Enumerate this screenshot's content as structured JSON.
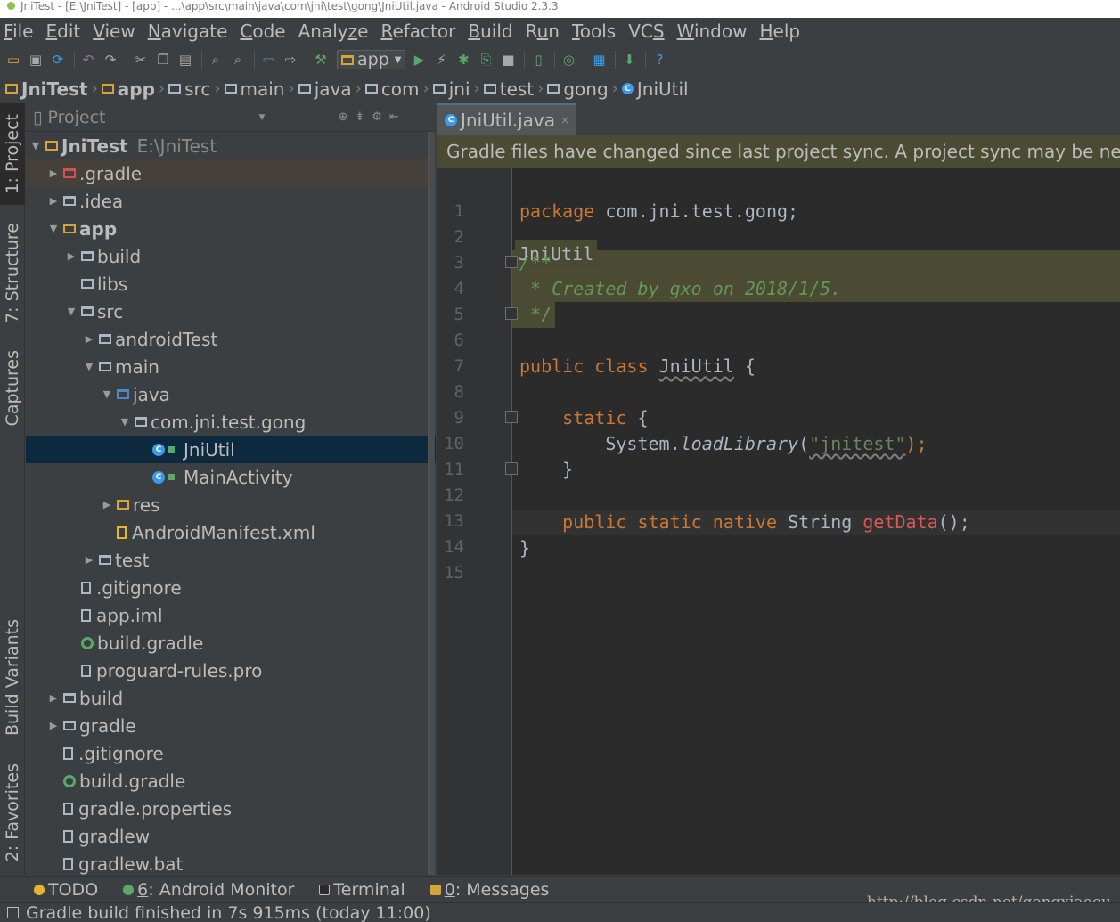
{
  "window": {
    "title": "JniTest - [E:\\JniTest] - [app] - ...\\app\\src\\main\\java\\com\\jni\\test\\gong\\JniUtil.java - Android Studio 2.3.3"
  },
  "menu": [
    {
      "mnemonic": "F",
      "rest": "ile"
    },
    {
      "mnemonic": "E",
      "rest": "dit"
    },
    {
      "mnemonic": "V",
      "rest": "iew"
    },
    {
      "mnemonic": "N",
      "rest": "avigate"
    },
    {
      "mnemonic": "C",
      "rest": "ode"
    },
    {
      "pre": "Analy",
      "mnemonic": "z",
      "rest": "e"
    },
    {
      "mnemonic": "R",
      "rest": "efactor"
    },
    {
      "mnemonic": "B",
      "rest": "uild"
    },
    {
      "pre": "R",
      "mnemonic": "u",
      "rest": "n"
    },
    {
      "mnemonic": "T",
      "rest": "ools"
    },
    {
      "pre": "VC",
      "mnemonic": "S",
      "rest": ""
    },
    {
      "mnemonic": "W",
      "rest": "indow"
    },
    {
      "mnemonic": "H",
      "rest": "elp"
    }
  ],
  "toolbar": {
    "run_config": "app"
  },
  "breadcrumbs": [
    "JniTest",
    "app",
    "src",
    "main",
    "java",
    "com",
    "jni",
    "test",
    "gong",
    "JniUtil"
  ],
  "project_panel": {
    "title": "Project",
    "root_name": "JniTest",
    "root_path": "E:\\JniTest",
    "items": [
      ".gradle",
      ".idea",
      "app",
      "build",
      "libs",
      "src",
      "androidTest",
      "main",
      "java",
      "com.jni.test.gong",
      "JniUtil",
      "MainActivity",
      "res",
      "AndroidManifest.xml",
      "test",
      ".gitignore",
      "app.iml",
      "build.gradle",
      "proguard-rules.pro",
      "build",
      "gradle",
      ".gitignore",
      "build.gradle",
      "gradle.properties",
      "gradlew",
      "gradlew.bat"
    ]
  },
  "left_tool_tabs": {
    "project": "1: Project",
    "structure": "7: Structure",
    "captures": "Captures",
    "build_variants": "Build Variants",
    "favorites": "2: Favorites"
  },
  "editor": {
    "tab_label": "JniUtil.java",
    "banner": "Gradle files have changed since last project sync. A project sync may be necessary for the IDE to work properly.",
    "breadcrumb_chip": "JniUtil",
    "line_numbers": [
      "1",
      "2",
      "3",
      "4",
      "5",
      "6",
      "7",
      "8",
      "9",
      "10",
      "11",
      "12",
      "13",
      "14",
      "15"
    ],
    "code": {
      "package_kw": "package",
      "package_name": " com.jni.test.gong;",
      "comment_open": "/**",
      "comment_body": " * Created by gxo on 2018/1/5.",
      "comment_close": " */",
      "public_kw": "public",
      "class_kw": "class",
      "class_name": "JniUtil",
      "open_brace": " {",
      "static_kw": "static",
      "system_call": "System.",
      "load_fn": "loadLibrary",
      "paren_open": "(",
      "lib_string": "\"jnitest\"",
      "paren_close": ");",
      "close_brace": "}",
      "native_kw": "public static native",
      "string_type": " String ",
      "method_name": "getData",
      "method_tail": "();",
      "class_close": "}"
    }
  },
  "bottom_tabs": {
    "todo": "TODO",
    "monitor_num": "6",
    "monitor_label": ": Android Monitor",
    "terminal": "Terminal",
    "messages_num": "0",
    "messages_label": ": Messages"
  },
  "status": {
    "text": "Gradle build finished in 7s 915ms (today 11:00)"
  },
  "watermark": "http://blog.csdn.net/gongxiaoou"
}
